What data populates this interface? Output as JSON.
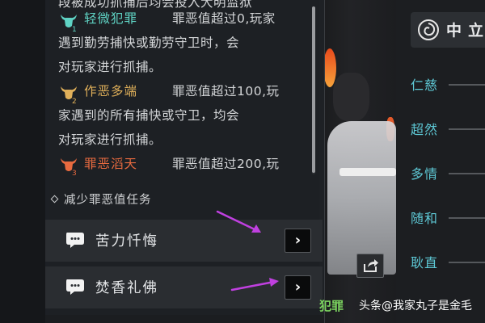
{
  "crime_panel": {
    "top_partial_line": "段被成功抓捕后均会投入大明监狱",
    "levels": [
      {
        "name": "轻微犯罪",
        "color": "#5fd3c4",
        "icon": "ox-head-level-1-icon",
        "lines": [
          "罪恶值超过0,玩家",
          "遇到勤劳捕快或勤劳守卫时，会",
          "对玩家进行抓捕。"
        ]
      },
      {
        "name": "作恶多端",
        "color": "#e0b05a",
        "icon": "ox-head-level-2-icon",
        "lines": [
          "罪恶值超过100,玩",
          "家遇到的所有捕快或守卫，均会",
          "对玩家进行抓捕。"
        ]
      },
      {
        "name": "罪恶滔天",
        "color": "#e86a3f",
        "icon": "ox-head-level-3-icon",
        "lines": [
          "罪恶值超过200,玩"
        ]
      }
    ]
  },
  "tasks_section": {
    "title": "减少罪恶值任务",
    "tasks": [
      {
        "label": "苦力忏悔",
        "icon": "scroll-speech-icon",
        "button": "›"
      },
      {
        "label": "焚香礼佛",
        "icon": "scroll-speech-icon",
        "button": "›"
      }
    ]
  },
  "attribute_panel": {
    "header_title": "中立",
    "logo_icon": "spiral-logo-icon",
    "attributes": [
      "仁慈",
      "超然",
      "多情",
      "随和",
      "耿直"
    ]
  },
  "bottom_crime_label": "犯罪",
  "watermark": {
    "source": "头条",
    "author": "@我家丸子是金毛"
  },
  "icons": {
    "share": "share-icon",
    "annotation": "pink-arrow-icon"
  },
  "colors": {
    "accent_teal": "#5ec9d6",
    "arrow_pink": "#c040e0"
  }
}
